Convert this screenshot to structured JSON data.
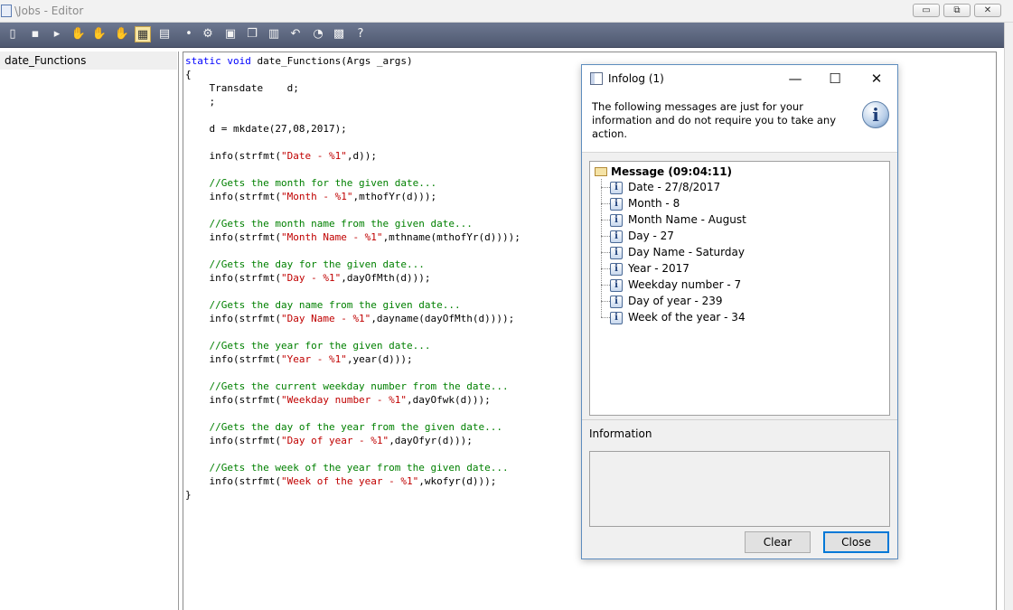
{
  "window": {
    "title": "\\Jobs - Editor",
    "minimize_glyph": "▭",
    "restore_glyph": "⧉",
    "close_glyph": "✕"
  },
  "toolbar": {
    "icons": [
      "new-icon",
      "save-icon",
      "run-icon",
      "hand-icon",
      "hand-icon-2",
      "hand-icon-3",
      "highlight-icon",
      "view-icon",
      "breakpoint-icon",
      "compile-icon",
      "properties-icon",
      "copy-icon",
      "database-icon",
      "undo-icon",
      "clock-icon",
      "tools-icon",
      "help-icon"
    ]
  },
  "tree": {
    "item": "date_Functions"
  },
  "code": {
    "lines": [
      [
        {
          "t": "static void ",
          "c": "kw"
        },
        {
          "t": "date_Functions(Args _args)",
          "c": "nm"
        }
      ],
      [
        {
          "t": "{",
          "c": "nm"
        }
      ],
      [
        {
          "t": "    Transdate    d;",
          "c": "nm"
        }
      ],
      [
        {
          "t": "    ;",
          "c": "nm"
        }
      ],
      [
        {
          "t": "",
          "c": "nm"
        }
      ],
      [
        {
          "t": "    d = mkdate(27,08,2017);",
          "c": "nm"
        }
      ],
      [
        {
          "t": "",
          "c": "nm"
        }
      ],
      [
        {
          "t": "    info(strfmt(",
          "c": "nm"
        },
        {
          "t": "\"Date - %1\"",
          "c": "st"
        },
        {
          "t": ",d));",
          "c": "nm"
        }
      ],
      [
        {
          "t": "",
          "c": "nm"
        }
      ],
      [
        {
          "t": "    //Gets the month for the given date...",
          "c": "cm"
        }
      ],
      [
        {
          "t": "    info(strfmt(",
          "c": "nm"
        },
        {
          "t": "\"Month - %1\"",
          "c": "st"
        },
        {
          "t": ",mthofYr(d)));",
          "c": "nm"
        }
      ],
      [
        {
          "t": "",
          "c": "nm"
        }
      ],
      [
        {
          "t": "    //Gets the month name from the given date...",
          "c": "cm"
        }
      ],
      [
        {
          "t": "    info(strfmt(",
          "c": "nm"
        },
        {
          "t": "\"Month Name - %1\"",
          "c": "st"
        },
        {
          "t": ",mthname(mthofYr(d))));",
          "c": "nm"
        }
      ],
      [
        {
          "t": "",
          "c": "nm"
        }
      ],
      [
        {
          "t": "    //Gets the day for the given date...",
          "c": "cm"
        }
      ],
      [
        {
          "t": "    info(strfmt(",
          "c": "nm"
        },
        {
          "t": "\"Day - %1\"",
          "c": "st"
        },
        {
          "t": ",dayOfMth(d)));",
          "c": "nm"
        }
      ],
      [
        {
          "t": "",
          "c": "nm"
        }
      ],
      [
        {
          "t": "    //Gets the day name from the given date...",
          "c": "cm"
        }
      ],
      [
        {
          "t": "    info(strfmt(",
          "c": "nm"
        },
        {
          "t": "\"Day Name - %1\"",
          "c": "st"
        },
        {
          "t": ",dayname(dayOfMth(d))));",
          "c": "nm"
        }
      ],
      [
        {
          "t": "",
          "c": "nm"
        }
      ],
      [
        {
          "t": "    //Gets the year for the given date...",
          "c": "cm"
        }
      ],
      [
        {
          "t": "    info(strfmt(",
          "c": "nm"
        },
        {
          "t": "\"Year - %1\"",
          "c": "st"
        },
        {
          "t": ",year(d)));",
          "c": "nm"
        }
      ],
      [
        {
          "t": "",
          "c": "nm"
        }
      ],
      [
        {
          "t": "    //Gets the current weekday number from the date...",
          "c": "cm"
        }
      ],
      [
        {
          "t": "    info(strfmt(",
          "c": "nm"
        },
        {
          "t": "\"Weekday number - %1\"",
          "c": "st"
        },
        {
          "t": ",dayOfwk(d)));",
          "c": "nm"
        }
      ],
      [
        {
          "t": "",
          "c": "nm"
        }
      ],
      [
        {
          "t": "    //Gets the day of the year from the given date...",
          "c": "cm"
        }
      ],
      [
        {
          "t": "    info(strfmt(",
          "c": "nm"
        },
        {
          "t": "\"Day of year - %1\"",
          "c": "st"
        },
        {
          "t": ",dayOfyr(d)));",
          "c": "nm"
        }
      ],
      [
        {
          "t": "",
          "c": "nm"
        }
      ],
      [
        {
          "t": "    //Gets the week of the year from the given date...",
          "c": "cm"
        }
      ],
      [
        {
          "t": "    info(strfmt(",
          "c": "nm"
        },
        {
          "t": "\"Week of the year - %1\"",
          "c": "st"
        },
        {
          "t": ",wkofyr(d)));",
          "c": "nm"
        }
      ],
      [
        {
          "t": "}",
          "c": "nm"
        }
      ]
    ]
  },
  "infolog": {
    "title": "Infolog (1)",
    "header_message": "The following messages are just for your information and do not require you to take any action.",
    "root": "Message (09:04:11)",
    "messages": [
      "Date - 27/8/2017",
      "Month - 8",
      "Month Name - August",
      "Day - 27",
      "Day Name - Saturday",
      "Year - 2017",
      "Weekday number - 7",
      "Day of year - 239",
      "Week of the year - 34"
    ],
    "info_label": "Information",
    "clear_label": "Clear",
    "close_label": "Close",
    "minimize_glyph": "—",
    "maximize_glyph": "☐",
    "close_glyph": "✕",
    "info_glyph": "i"
  },
  "colors": {
    "keyword": "#0000ff",
    "comment": "#008000",
    "string": "#c00000",
    "toolbar": "#5b6680"
  }
}
